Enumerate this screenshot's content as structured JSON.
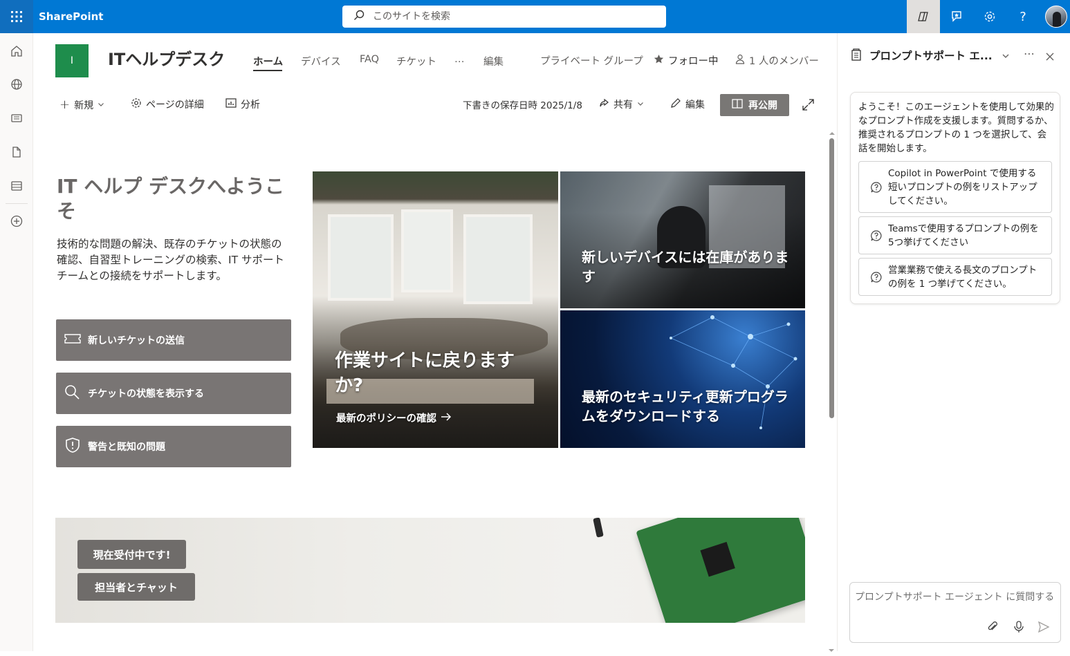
{
  "topbar": {
    "app_name": "SharePoint",
    "search_placeholder": "このサイトを検索",
    "help_label": "?"
  },
  "site": {
    "logo_letter": "I",
    "title": "ITヘルプデスク",
    "nav": [
      "ホーム",
      "デバイス",
      "FAQ",
      "チケット",
      "…",
      "編集"
    ],
    "privacy": "プライベート グループ",
    "follow": "フォロー中",
    "members": "1 人のメンバー"
  },
  "commandbar": {
    "new": "新規",
    "page_details": "ページの詳細",
    "analytics": "分析",
    "draft_saved": "下書きの保存日時 2025/1/8",
    "share": "共有",
    "edit": "編集",
    "republish": "再公開"
  },
  "welcome": {
    "title": "IT ヘルプ デスクへようこそ",
    "description": "技術的な問題の解決、既存のチケットの状態の確認、自習型トレーニングの検索、IT サポート チームとの接続をサポートします。",
    "buttons": [
      "新しいチケットの送信",
      "チケットの状態を表示する",
      "警告と既知の問題"
    ]
  },
  "hero": {
    "main_title": "作業サイトに戻りますか?",
    "main_link": "最新のポリシーの確認",
    "devices_title": "新しいデバイスには在庫があります",
    "security_title": "最新のセキュリティ更新プログラムをダウンロードする"
  },
  "banner": {
    "status": "現在受付中です!",
    "chat": "担当者とチャット"
  },
  "pane": {
    "title": "プロンプトサポート エ...",
    "intro": "ようこそ！このエージェントを使用して効果的なプロンプト作成を支援します。質問するか、推奨されるプロンプトの 1 つを選択して、会話を開始します。",
    "suggestions": [
      "Copilot in PowerPoint で使用する短いプロンプトの例をリストアップしてください。",
      "Teamsで使用するプロンプトの例を5つ挙げてください",
      "営業業務で使える長文のプロンプトの例を 1 つ挙げてください。"
    ],
    "input_placeholder": "プロンプトサポート エージェント に質問する"
  }
}
